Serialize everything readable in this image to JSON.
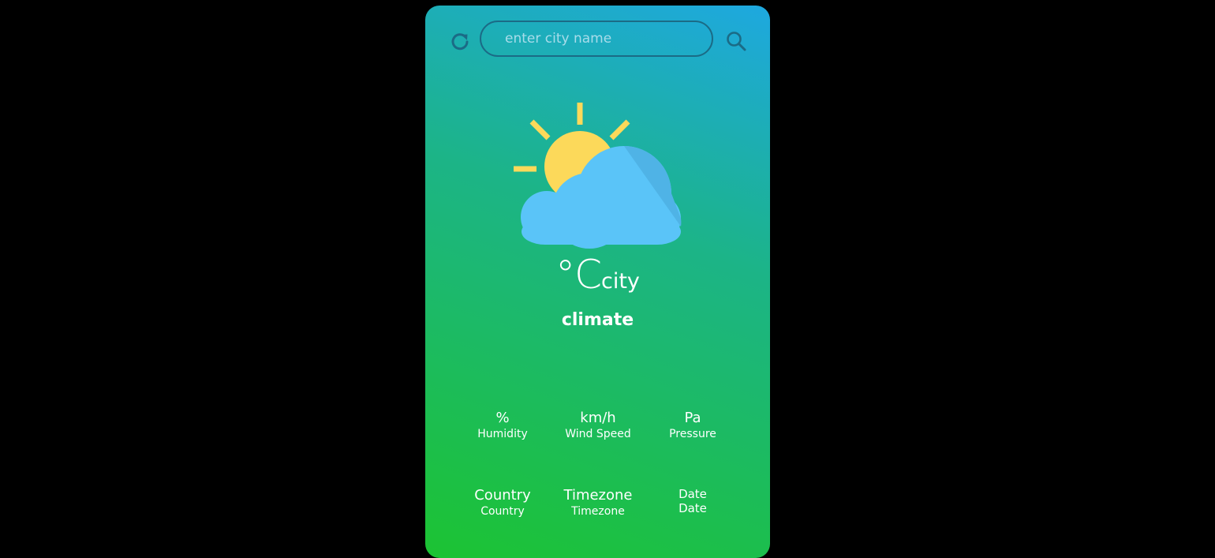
{
  "search": {
    "placeholder": "enter city name"
  },
  "icons": {
    "refresh": "refresh-icon",
    "search": "search-icon",
    "weather": "partly-cloudy-icon"
  },
  "weather": {
    "temperature": "°C",
    "city": "city",
    "climate": "climate"
  },
  "stats": {
    "humidity": {
      "value": "%",
      "label": "Humidity"
    },
    "wind": {
      "value": "km/h",
      "label": "Wind Speed"
    },
    "pressure": {
      "value": "Pa",
      "label": "Pressure"
    },
    "country": {
      "value": "Country",
      "label": "Country"
    },
    "timezone": {
      "value": "Timezone",
      "label": "Timezone"
    },
    "date": {
      "value": "Date",
      "label": "Date"
    }
  },
  "colors": {
    "background": "#000000",
    "gradient_top": "#1ea8e0",
    "gradient_bottom": "#1cc332",
    "sun": "#fcd95a",
    "cloud": "#5ac4f8",
    "icon_dark": "#1b6b86"
  }
}
